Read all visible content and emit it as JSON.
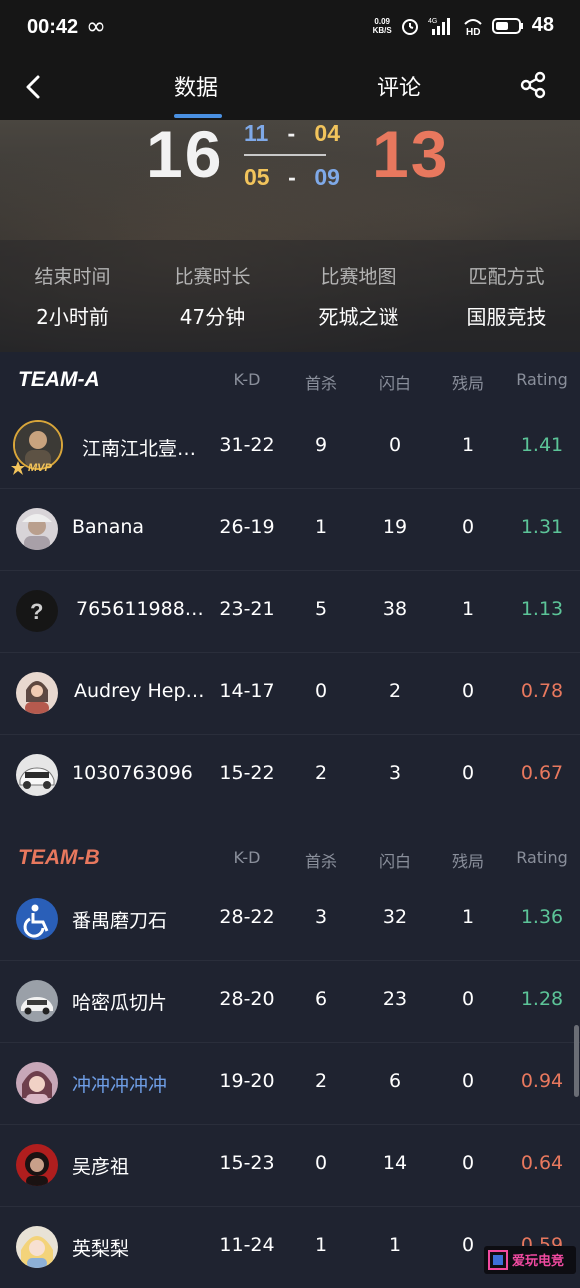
{
  "status_bar": {
    "time": "00:42",
    "net_speed_value": "0.09",
    "net_speed_unit": "KB/S",
    "network": "4G",
    "battery": "48"
  },
  "nav": {
    "tabs": [
      "数据",
      "评论"
    ],
    "active_tab": "数据"
  },
  "score": {
    "team_a": "16",
    "team_b": "13",
    "halves": [
      {
        "a": "11",
        "sep": "-",
        "b": "04"
      },
      {
        "a": "05",
        "sep": "-",
        "b": "09"
      }
    ]
  },
  "match_info": [
    {
      "label": "结束时间",
      "value": "2小时前"
    },
    {
      "label": "比赛时长",
      "value": "47分钟"
    },
    {
      "label": "比赛地图",
      "value": "死城之谜"
    },
    {
      "label": "匹配方式",
      "value": "国服竞技"
    }
  ],
  "columns": [
    "K-D",
    "首杀",
    "闪白",
    "残局",
    "Rating"
  ],
  "team_a": {
    "name": "TEAM-A",
    "players": [
      {
        "name": "江南江北壹…",
        "kd": "31-22",
        "first_kill": "9",
        "flash": "0",
        "clutch": "1",
        "rating": "1.41",
        "mvp": "MVP"
      },
      {
        "name": "Banana",
        "kd": "26-19",
        "first_kill": "1",
        "flash": "19",
        "clutch": "0",
        "rating": "1.31"
      },
      {
        "name": "7656119881…",
        "kd": "23-21",
        "first_kill": "5",
        "flash": "38",
        "clutch": "1",
        "rating": "1.13"
      },
      {
        "name": "Audrey Hepb…",
        "kd": "14-17",
        "first_kill": "0",
        "flash": "2",
        "clutch": "0",
        "rating": "0.78"
      },
      {
        "name": "1030763096",
        "kd": "15-22",
        "first_kill": "2",
        "flash": "3",
        "clutch": "0",
        "rating": "0.67"
      }
    ]
  },
  "team_b": {
    "name": "TEAM-B",
    "players": [
      {
        "name": "番禺磨刀石",
        "kd": "28-22",
        "first_kill": "3",
        "flash": "32",
        "clutch": "1",
        "rating": "1.36"
      },
      {
        "name": "哈密瓜切片",
        "kd": "28-20",
        "first_kill": "6",
        "flash": "23",
        "clutch": "0",
        "rating": "1.28"
      },
      {
        "name": "冲冲冲冲冲",
        "kd": "19-20",
        "first_kill": "2",
        "flash": "6",
        "clutch": "0",
        "rating": "0.94"
      },
      {
        "name": "吴彦祖",
        "kd": "15-23",
        "first_kill": "0",
        "flash": "14",
        "clutch": "0",
        "rating": "0.64"
      },
      {
        "name": "英梨梨",
        "kd": "11-24",
        "first_kill": "1",
        "flash": "1",
        "clutch": "0",
        "rating": "0.59"
      }
    ]
  },
  "colors": {
    "rating_good": "#5cc498",
    "rating_bad": "#e8785e",
    "team_b_accent": "#e8785e",
    "tab_accent": "#4a90e2"
  },
  "watermark": "爱玩电竞"
}
